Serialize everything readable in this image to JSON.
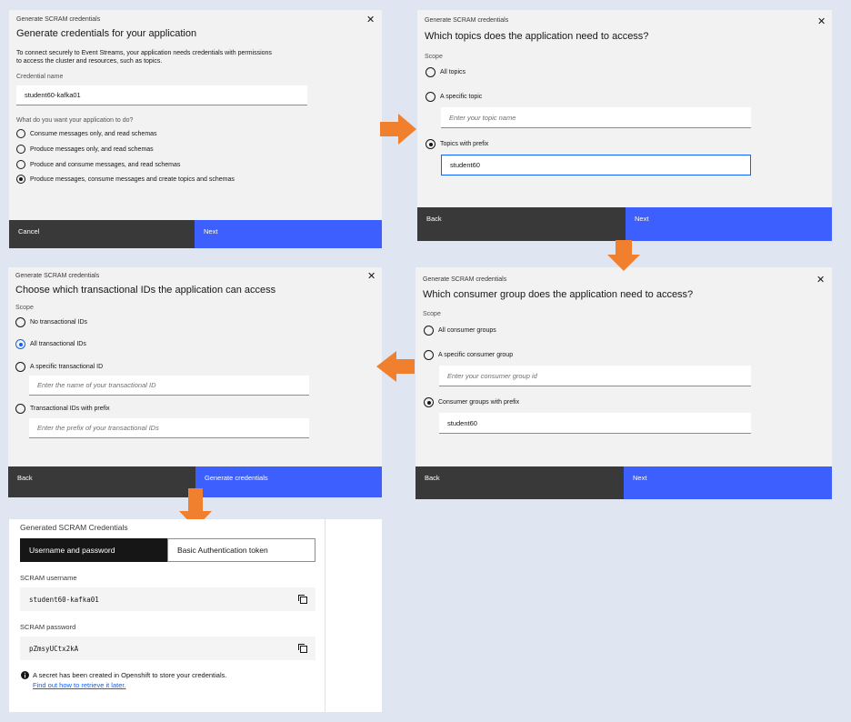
{
  "colors": {
    "accent": "#3d5ffe",
    "arrow": "#f07f2e",
    "background": "#dfe6f2"
  },
  "panel1": {
    "small_title": "Generate SCRAM credentials",
    "title": "Generate credentials for your application",
    "description": [
      "To connect securely to Event Streams, your application needs credentials with permissions",
      "to access the cluster and resources, such as topics."
    ],
    "credential_label": "Credential name",
    "credential_value": "student60-kafka01",
    "question": "What do you want your application to do?",
    "options": [
      {
        "label": "Consume messages only, and read schemas",
        "selected": false
      },
      {
        "label": "Produce messages only, and read schemas",
        "selected": false
      },
      {
        "label": "Produce and consume messages, and read schemas",
        "selected": false
      },
      {
        "label": "Produce messages, consume messages and create topics and schemas",
        "selected": true
      }
    ],
    "cancel": "Cancel",
    "next": "Next"
  },
  "panel2": {
    "small_title": "Generate SCRAM credentials",
    "title": "Which topics does the application need to access?",
    "scope": "Scope",
    "opt_all": "All topics",
    "opt_specific": "A specific topic",
    "specific_placeholder": "Enter your topic name",
    "opt_prefix": "Topics with prefix",
    "prefix_value": "student60",
    "back": "Back",
    "next": "Next"
  },
  "panel3": {
    "small_title": "Generate SCRAM credentials",
    "title": "Choose which transactional IDs the application can access",
    "scope": "Scope",
    "opt_none": "No transactional IDs",
    "opt_all": "All transactional IDs",
    "opt_specific": "A specific transactional ID",
    "specific_placeholder": "Enter the name of your transactional ID",
    "opt_prefix": "Transactional IDs with prefix",
    "prefix_placeholder": "Enter the prefix of your transactional IDs",
    "back": "Back",
    "generate": "Generate credentials"
  },
  "panel4": {
    "small_title": "Generate SCRAM credentials",
    "title": "Which consumer group does the application need to access?",
    "scope": "Scope",
    "opt_all": "All consumer groups",
    "opt_specific": "A specific consumer group",
    "specific_placeholder": "Enter your consumer group id",
    "opt_prefix": "Consumer groups with prefix",
    "prefix_value": "student60",
    "back": "Back",
    "next": "Next"
  },
  "panel5": {
    "title": "Generated SCRAM Credentials",
    "tab_active": "Username and password",
    "tab_inactive": "Basic Authentication token",
    "username_label": "SCRAM username",
    "username_value": "student60-kafka01",
    "password_label": "SCRAM password",
    "password_value": "pZmsyUCtx2kA",
    "notice": "A secret has been created in Openshift to store your credentials.",
    "notice_link": "Find out how to retrieve it later."
  }
}
